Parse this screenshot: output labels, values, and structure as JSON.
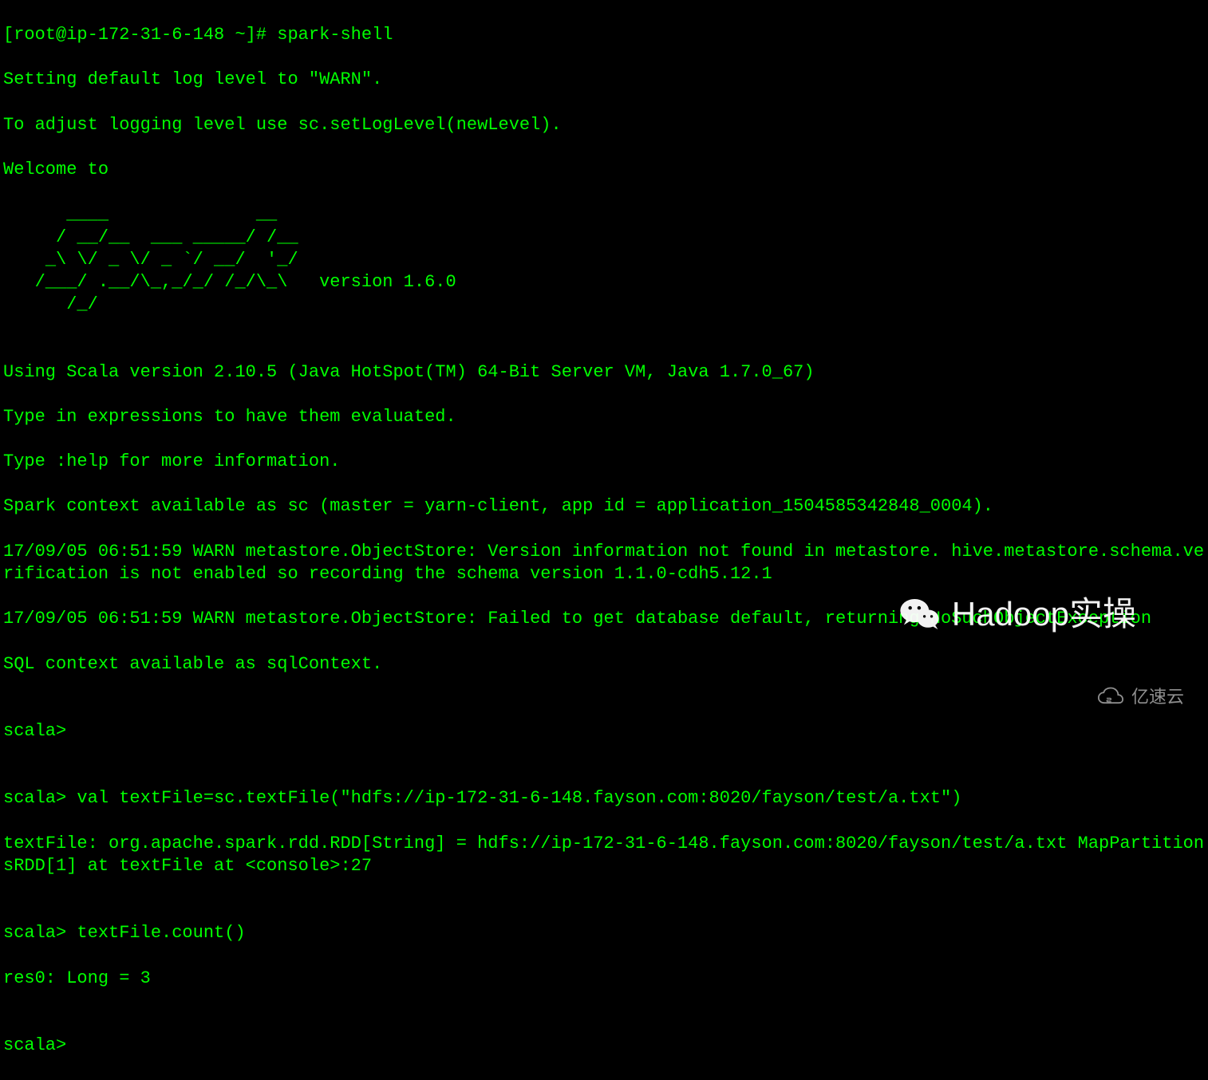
{
  "terminal": {
    "prompt_line": "[root@ip-172-31-6-148 ~]# spark-shell",
    "line_log1": "Setting default log level to \"WARN\".",
    "line_log2": "To adjust logging level use sc.setLogLevel(newLevel).",
    "line_welcome": "Welcome to",
    "ascii_art": "      ____              __\n     / __/__  ___ _____/ /__\n    _\\ \\/ _ \\/ _ `/ __/  '_/\n   /___/ .__/\\_,_/_/ /_/\\_\\   version 1.6.0\n      /_/",
    "blank1": "",
    "line_scala": "Using Scala version 2.10.5 (Java HotSpot(TM) 64-Bit Server VM, Java 1.7.0_67)",
    "line_type1": "Type in expressions to have them evaluated.",
    "line_type2": "Type :help for more information.",
    "line_sc": "Spark context available as sc (master = yarn-client, app id = application_1504585342848_0004).",
    "line_warn1": "17/09/05 06:51:59 WARN metastore.ObjectStore: Version information not found in metastore. hive.metastore.schema.verification is not enabled so recording the schema version 1.1.0-cdh5.12.1",
    "line_warn2": "17/09/05 06:51:59 WARN metastore.ObjectStore: Failed to get database default, returning NoSuchObjectException",
    "line_sql": "SQL context available as sqlContext.",
    "blank2": "",
    "scala_prompt1": "scala>",
    "blank3": "",
    "scala_cmd1": "scala> val textFile=sc.textFile(\"hdfs://ip-172-31-6-148.fayson.com:8020/fayson/test/a.txt\")",
    "scala_out1": "textFile: org.apache.spark.rdd.RDD[String] = hdfs://ip-172-31-6-148.fayson.com:8020/fayson/test/a.txt MapPartitionsRDD[1] at textFile at <console>:27",
    "blank4": "",
    "scala_cmd2": "scala> textFile.count()",
    "scala_out2": "res0: Long = 3",
    "blank5": "",
    "scala_prompt2": "scala>"
  },
  "watermarks": {
    "hadoop_label": "Hadoop实操",
    "ysy_label": "亿速云"
  }
}
